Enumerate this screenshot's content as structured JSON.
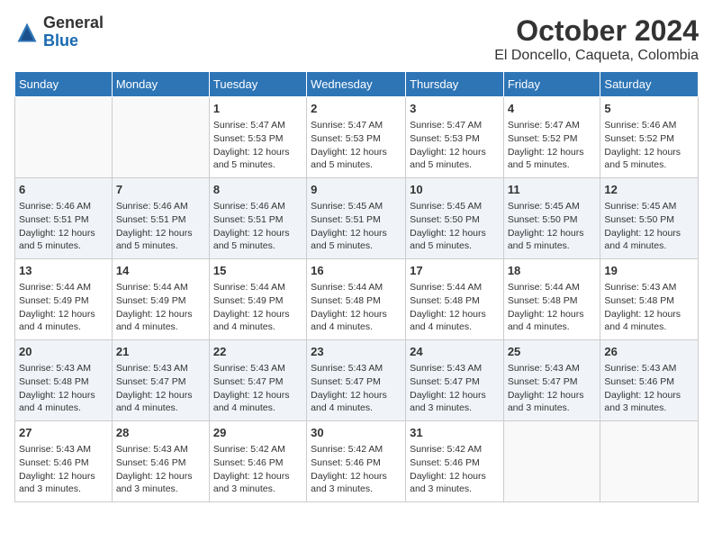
{
  "header": {
    "logo_general": "General",
    "logo_blue": "Blue",
    "month_title": "October 2024",
    "location": "El Doncello, Caqueta, Colombia"
  },
  "days_of_week": [
    "Sunday",
    "Monday",
    "Tuesday",
    "Wednesday",
    "Thursday",
    "Friday",
    "Saturday"
  ],
  "weeks": [
    [
      {
        "day": "",
        "content": ""
      },
      {
        "day": "",
        "content": ""
      },
      {
        "day": "1",
        "content": "Sunrise: 5:47 AM\nSunset: 5:53 PM\nDaylight: 12 hours and 5 minutes."
      },
      {
        "day": "2",
        "content": "Sunrise: 5:47 AM\nSunset: 5:53 PM\nDaylight: 12 hours and 5 minutes."
      },
      {
        "day": "3",
        "content": "Sunrise: 5:47 AM\nSunset: 5:53 PM\nDaylight: 12 hours and 5 minutes."
      },
      {
        "day": "4",
        "content": "Sunrise: 5:47 AM\nSunset: 5:52 PM\nDaylight: 12 hours and 5 minutes."
      },
      {
        "day": "5",
        "content": "Sunrise: 5:46 AM\nSunset: 5:52 PM\nDaylight: 12 hours and 5 minutes."
      }
    ],
    [
      {
        "day": "6",
        "content": "Sunrise: 5:46 AM\nSunset: 5:51 PM\nDaylight: 12 hours and 5 minutes."
      },
      {
        "day": "7",
        "content": "Sunrise: 5:46 AM\nSunset: 5:51 PM\nDaylight: 12 hours and 5 minutes."
      },
      {
        "day": "8",
        "content": "Sunrise: 5:46 AM\nSunset: 5:51 PM\nDaylight: 12 hours and 5 minutes."
      },
      {
        "day": "9",
        "content": "Sunrise: 5:45 AM\nSunset: 5:51 PM\nDaylight: 12 hours and 5 minutes."
      },
      {
        "day": "10",
        "content": "Sunrise: 5:45 AM\nSunset: 5:50 PM\nDaylight: 12 hours and 5 minutes."
      },
      {
        "day": "11",
        "content": "Sunrise: 5:45 AM\nSunset: 5:50 PM\nDaylight: 12 hours and 5 minutes."
      },
      {
        "day": "12",
        "content": "Sunrise: 5:45 AM\nSunset: 5:50 PM\nDaylight: 12 hours and 4 minutes."
      }
    ],
    [
      {
        "day": "13",
        "content": "Sunrise: 5:44 AM\nSunset: 5:49 PM\nDaylight: 12 hours and 4 minutes."
      },
      {
        "day": "14",
        "content": "Sunrise: 5:44 AM\nSunset: 5:49 PM\nDaylight: 12 hours and 4 minutes."
      },
      {
        "day": "15",
        "content": "Sunrise: 5:44 AM\nSunset: 5:49 PM\nDaylight: 12 hours and 4 minutes."
      },
      {
        "day": "16",
        "content": "Sunrise: 5:44 AM\nSunset: 5:48 PM\nDaylight: 12 hours and 4 minutes."
      },
      {
        "day": "17",
        "content": "Sunrise: 5:44 AM\nSunset: 5:48 PM\nDaylight: 12 hours and 4 minutes."
      },
      {
        "day": "18",
        "content": "Sunrise: 5:44 AM\nSunset: 5:48 PM\nDaylight: 12 hours and 4 minutes."
      },
      {
        "day": "19",
        "content": "Sunrise: 5:43 AM\nSunset: 5:48 PM\nDaylight: 12 hours and 4 minutes."
      }
    ],
    [
      {
        "day": "20",
        "content": "Sunrise: 5:43 AM\nSunset: 5:48 PM\nDaylight: 12 hours and 4 minutes."
      },
      {
        "day": "21",
        "content": "Sunrise: 5:43 AM\nSunset: 5:47 PM\nDaylight: 12 hours and 4 minutes."
      },
      {
        "day": "22",
        "content": "Sunrise: 5:43 AM\nSunset: 5:47 PM\nDaylight: 12 hours and 4 minutes."
      },
      {
        "day": "23",
        "content": "Sunrise: 5:43 AM\nSunset: 5:47 PM\nDaylight: 12 hours and 4 minutes."
      },
      {
        "day": "24",
        "content": "Sunrise: 5:43 AM\nSunset: 5:47 PM\nDaylight: 12 hours and 3 minutes."
      },
      {
        "day": "25",
        "content": "Sunrise: 5:43 AM\nSunset: 5:47 PM\nDaylight: 12 hours and 3 minutes."
      },
      {
        "day": "26",
        "content": "Sunrise: 5:43 AM\nSunset: 5:46 PM\nDaylight: 12 hours and 3 minutes."
      }
    ],
    [
      {
        "day": "27",
        "content": "Sunrise: 5:43 AM\nSunset: 5:46 PM\nDaylight: 12 hours and 3 minutes."
      },
      {
        "day": "28",
        "content": "Sunrise: 5:43 AM\nSunset: 5:46 PM\nDaylight: 12 hours and 3 minutes."
      },
      {
        "day": "29",
        "content": "Sunrise: 5:42 AM\nSunset: 5:46 PM\nDaylight: 12 hours and 3 minutes."
      },
      {
        "day": "30",
        "content": "Sunrise: 5:42 AM\nSunset: 5:46 PM\nDaylight: 12 hours and 3 minutes."
      },
      {
        "day": "31",
        "content": "Sunrise: 5:42 AM\nSunset: 5:46 PM\nDaylight: 12 hours and 3 minutes."
      },
      {
        "day": "",
        "content": ""
      },
      {
        "day": "",
        "content": ""
      }
    ]
  ]
}
